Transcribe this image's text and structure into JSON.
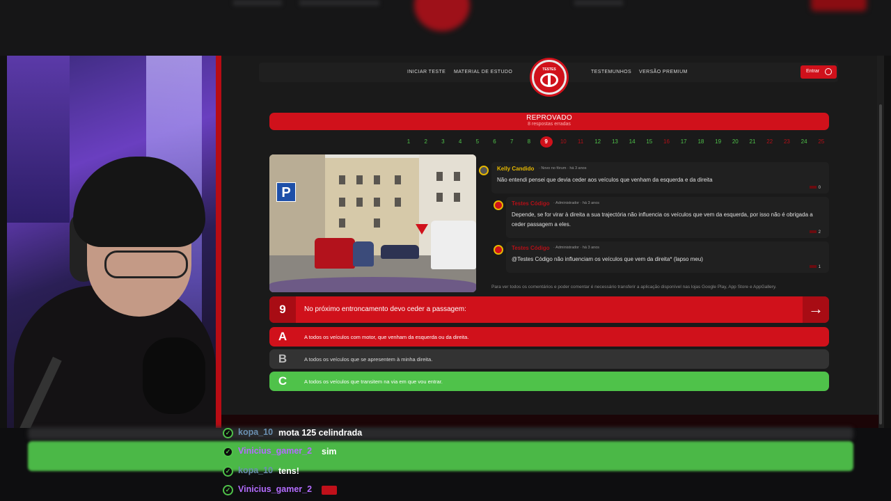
{
  "nav": {
    "links": [
      "INICIAR TESTE",
      "MATERIAL DE ESTUDO",
      "TESTEMUNHOS",
      "VERSÃO PREMIUM"
    ],
    "logo_text": "TESTES",
    "enter_label": "Entrar"
  },
  "result": {
    "title": "REPROVADO",
    "subtitle": "8 respostas erradas"
  },
  "question_numbers": [
    {
      "n": "1",
      "state": "ok"
    },
    {
      "n": "2",
      "state": "ok"
    },
    {
      "n": "3",
      "state": "ok"
    },
    {
      "n": "4",
      "state": "ok"
    },
    {
      "n": "5",
      "state": "ok"
    },
    {
      "n": "6",
      "state": "ok"
    },
    {
      "n": "7",
      "state": "ok"
    },
    {
      "n": "8",
      "state": "ok"
    },
    {
      "n": "9",
      "state": "current"
    },
    {
      "n": "10",
      "state": "bad"
    },
    {
      "n": "11",
      "state": "bad"
    },
    {
      "n": "12",
      "state": "ok"
    },
    {
      "n": "13",
      "state": "ok"
    },
    {
      "n": "14",
      "state": "ok"
    },
    {
      "n": "15",
      "state": "ok"
    },
    {
      "n": "16",
      "state": "bad"
    },
    {
      "n": "17",
      "state": "ok"
    },
    {
      "n": "18",
      "state": "ok"
    },
    {
      "n": "19",
      "state": "ok"
    },
    {
      "n": "20",
      "state": "ok"
    },
    {
      "n": "21",
      "state": "ok"
    },
    {
      "n": "22",
      "state": "bad"
    },
    {
      "n": "23",
      "state": "bad"
    },
    {
      "n": "24",
      "state": "ok"
    },
    {
      "n": "25",
      "state": "bad"
    }
  ],
  "comments": [
    {
      "name": "Kelly Candido",
      "meta": "· Novo no fórum · há 3 anos",
      "text": "Não entendi pensei que devia ceder aos veículos que venham da esquerda e da direita",
      "count": "0"
    },
    {
      "name": "Testes Código",
      "meta": "· Administrador · há 3 anos",
      "text": "Depende, se for virar à direita a sua trajectória não influencia os veículos que vem da esquerda, por isso não é obrigada a ceder passagem a eles.",
      "count": "2"
    },
    {
      "name": "Testes Código",
      "meta": "· Administrador · há 3 anos",
      "text": "@Testes Código não influenciam os veículos que vem da direita* (lapso meu)",
      "count": "1"
    }
  ],
  "comments_note": "Para ver todos os comentários e poder comentar é necessário transferir a aplicação disponível nas lojas Google Play, App Store e AppGallery.",
  "question": {
    "number": "9",
    "text": "No próximo entroncamento devo ceder a passagem:",
    "next_icon": "arrow-right-icon"
  },
  "answers": [
    {
      "key": "A",
      "text": "A todos os veículos com motor, que venham da esquerda ou da direita."
    },
    {
      "key": "B",
      "text": "A todos os veículos que se apresentem à minha direita."
    },
    {
      "key": "C",
      "text": "A todos os veículos que transitem na via em que vou entrar."
    }
  ],
  "chat": [
    {
      "user": "kopa_10",
      "msg": "mota 125 celindrada"
    },
    {
      "user": "Vinicius_gamer_2",
      "msg": "sim"
    },
    {
      "user": "kopa_10",
      "msg": "tens!"
    },
    {
      "user": "Vinicius_gamer_2",
      "msg": ""
    }
  ],
  "colors": {
    "accent_red": "#d0111b",
    "correct_green": "#4fc24a",
    "neutral": "#333333"
  }
}
